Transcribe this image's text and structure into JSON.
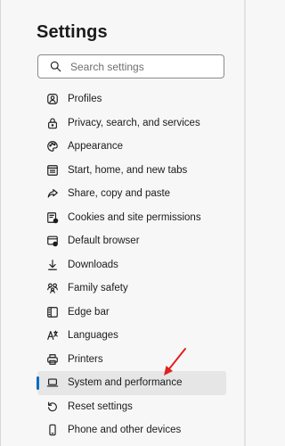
{
  "header": {
    "title": "Settings"
  },
  "search": {
    "placeholder": "Search settings"
  },
  "sidebar": {
    "selected_index": 12,
    "accent_color": "#0f6cbd",
    "items": [
      {
        "label": "Profiles",
        "icon": "profile-icon"
      },
      {
        "label": "Privacy, search, and services",
        "icon": "lock-icon"
      },
      {
        "label": "Appearance",
        "icon": "palette-icon"
      },
      {
        "label": "Start, home, and new tabs",
        "icon": "start-page-icon"
      },
      {
        "label": "Share, copy and paste",
        "icon": "share-icon"
      },
      {
        "label": "Cookies and site permissions",
        "icon": "cookies-icon"
      },
      {
        "label": "Default browser",
        "icon": "default-browser-icon"
      },
      {
        "label": "Downloads",
        "icon": "download-icon"
      },
      {
        "label": "Family safety",
        "icon": "family-icon"
      },
      {
        "label": "Edge bar",
        "icon": "edge-bar-icon"
      },
      {
        "label": "Languages",
        "icon": "languages-icon"
      },
      {
        "label": "Printers",
        "icon": "printer-icon"
      },
      {
        "label": "System and performance",
        "icon": "laptop-icon"
      },
      {
        "label": "Reset settings",
        "icon": "reset-icon"
      },
      {
        "label": "Phone and other devices",
        "icon": "phone-icon"
      }
    ]
  },
  "annotation": {
    "arrow_color": "#e02020"
  }
}
